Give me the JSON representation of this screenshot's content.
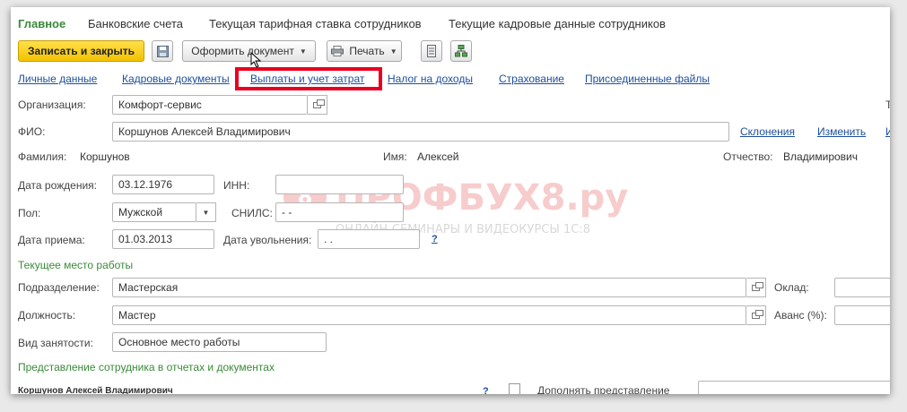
{
  "tabs": [
    "Главное",
    "Банковские счета",
    "Текущая тарифная ставка сотрудников",
    "Текущие кадровые данные сотрудников"
  ],
  "toolbar": {
    "save_close": "Записать и закрыть",
    "issue_document": "Оформить документ",
    "print": "Печать"
  },
  "links": [
    "Личные данные",
    "Кадровые документы",
    "Выплаты и учет затрат",
    "Налог на доходы",
    "Страхование",
    "Присоединенные файлы"
  ],
  "form": {
    "organization_label": "Организация:",
    "organization_value": "Комфорт-сервис",
    "fio_label": "ФИО:",
    "fio_value": "Коршунов Алексей Владимирович",
    "declension_link": "Склонения",
    "change_link": "Изменить",
    "surname_label": "Фамилия:",
    "surname_value": "Коршунов",
    "name_label": "Имя:",
    "name_value": "Алексей",
    "patronymic_label": "Отчество:",
    "patronymic_value": "Владимирович",
    "birth_label": "Дата рождения:",
    "birth_value": "03.12.1976",
    "inn_label": "ИНН:",
    "inn_value": "",
    "gender_label": "Пол:",
    "gender_value": "Мужской",
    "snils_label": "СНИЛС:",
    "snils_value": "-  -",
    "hire_label": "Дата приема:",
    "hire_value": "01.03.2013",
    "dismissal_label": "Дата увольнения:",
    "dismissal_value": " .  .",
    "help": "?"
  },
  "workplace": {
    "section_title": "Текущее место работы",
    "department_label": "Подразделение:",
    "department_value": "Мастерская",
    "salary_label": "Оклад:",
    "position_label": "Должность:",
    "position_value": "Мастер",
    "advance_label": "Аванс (%):",
    "employment_label": "Вид занятости:",
    "employment_value": "Основное место работы"
  },
  "representation": {
    "section_title": "Представление сотрудника в отчетах и документах",
    "name_display": "Коршунов Алексей Владимирович",
    "supplement_label": "Дополнять представление"
  },
  "watermark": {
    "brand": "ПРОФБУХ8.ру",
    "tagline": "ОНЛАЙН-СЕМИНАРЫ И ВИДЕОКУРСЫ 1С:8"
  },
  "colors": {
    "accent_green": "#3a8a3a",
    "link_blue": "#1c4f9c",
    "highlight_red": "#e8001f",
    "primary_button": "#f2c200"
  }
}
